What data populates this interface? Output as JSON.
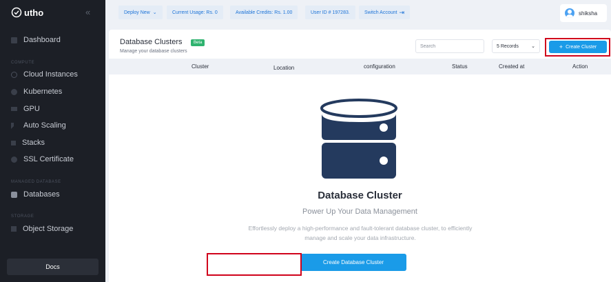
{
  "brand": {
    "name": "utho",
    "collapse_icon": "double-chevron-left-icon"
  },
  "sidebar": {
    "items": [
      {
        "label": "Dashboard",
        "icon": "dashboard-icon"
      },
      {
        "label": "Cloud Instances",
        "icon": "cloud-icon"
      },
      {
        "label": "Kubernetes",
        "icon": "kubernetes-icon"
      },
      {
        "label": "GPU",
        "icon": "gpu-icon"
      },
      {
        "label": "Auto Scaling",
        "icon": "auto-scaling-icon"
      },
      {
        "label": "Stacks",
        "icon": "stacks-icon"
      },
      {
        "label": "SSL Certificate",
        "icon": "ssl-icon"
      },
      {
        "label": "Databases",
        "icon": "database-icon"
      },
      {
        "label": "Object Storage",
        "icon": "object-storage-icon"
      }
    ],
    "sections": {
      "compute": "COMPUTE",
      "managed_database": "MANAGED DATABASE",
      "storage": "STORAGE"
    },
    "docs": "Docs"
  },
  "topbar": {
    "deploy_new": "Deploy New",
    "current_usage": "Current Usage: Rs. 0",
    "available_credits": "Available Credits: Rs. 1.00",
    "user_id": "User ID # 197283.",
    "switch_account": "Switch Account",
    "username": "shiksha"
  },
  "page": {
    "title": "Database Clusters",
    "badge": "Beta",
    "subtitle": "Manage your database clusters",
    "search_placeholder": "Search",
    "records": "5 Records",
    "create_button": "Create Cluster",
    "columns": [
      "Cluster",
      "Location",
      "configuration",
      "Status",
      "Created at",
      "Action"
    ]
  },
  "empty_state": {
    "icon": "database-server-icon",
    "title": "Database Cluster",
    "subtitle": "Power Up Your Data Management",
    "description": "Effortlessly deploy a high-performance and fault-tolerant database cluster, to efficiently manage and scale your data infrastructure.",
    "button": "Create Database Cluster"
  },
  "colors": {
    "accent": "#1a9be8",
    "sidebar_bg": "#1c1f26",
    "highlight": "#d0021b",
    "beta": "#2fb36f",
    "db_icon": "#243a5e"
  }
}
